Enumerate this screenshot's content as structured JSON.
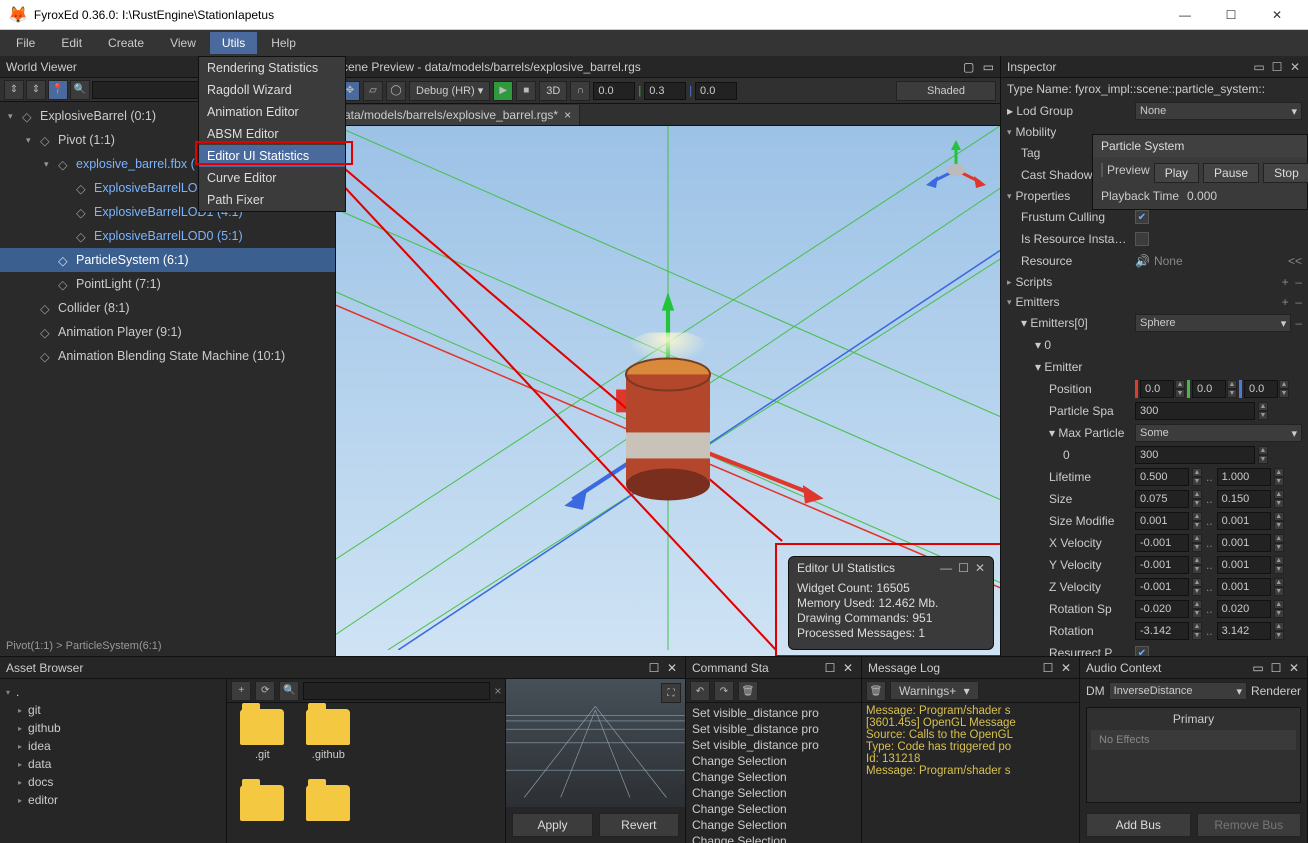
{
  "window": {
    "title": "FyroxEd  0.36.0: I:\\RustEngine\\StationIapetus"
  },
  "menubar": [
    "File",
    "Edit",
    "Create",
    "View",
    "Utils",
    "Help"
  ],
  "utils_dropdown": [
    "Rendering Statistics",
    "Ragdoll Wizard",
    "Animation Editor",
    "ABSM Editor",
    "Editor UI Statistics",
    "Curve Editor",
    "Path Fixer"
  ],
  "world": {
    "title": "World Viewer",
    "tree": [
      {
        "d": 0,
        "label": "ExplosiveBarrel (0:1)",
        "exp": "▾"
      },
      {
        "d": 1,
        "label": "Pivot (1:1)",
        "exp": "▾"
      },
      {
        "d": 2,
        "label": "explosive_barrel.fbx (",
        "exp": "▾",
        "link": true,
        "covered": true
      },
      {
        "d": 3,
        "label": "ExplosiveBarrelLOD",
        "link": true,
        "covered": true
      },
      {
        "d": 3,
        "label": "ExplosiveBarrelLOD1 (4:1)",
        "link": true
      },
      {
        "d": 3,
        "label": "ExplosiveBarrelLOD0 (5:1)",
        "link": true
      },
      {
        "d": 2,
        "label": "ParticleSystem (6:1)",
        "sel": true
      },
      {
        "d": 2,
        "label": "PointLight (7:1)"
      },
      {
        "d": 1,
        "label": "Collider (8:1)"
      },
      {
        "d": 1,
        "label": "Animation Player (9:1)"
      },
      {
        "d": 1,
        "label": "Animation Blending State Machine (10:1)"
      }
    ],
    "breadcrumb": "Pivot(1:1) > ParticleSystem(6:1)"
  },
  "scene": {
    "title_pre": "cene Preview - data/models/barrels/explosive_barrel.rgs",
    "tab": "ata/models/barrels/explosive_barrel.rgs*",
    "debug_label": "Debug (HR)",
    "shaded": "Shaded",
    "n1": "0.0",
    "n2": "0.3",
    "n3": "0.0",
    "threeD": "3D"
  },
  "stats": {
    "title": "Editor UI Statistics",
    "lines": [
      "Widget Count: 16505",
      "Memory Used: 12.462 Mb.",
      "Drawing Commands: 951",
      "Processed Messages: 1"
    ]
  },
  "inspector": {
    "title": "Inspector",
    "type_name": "Type Name: fyrox_impl::scene::particle_system::",
    "lod_group": "Lod Group",
    "lod_val": "None",
    "mobility": "Mobility",
    "tag": "Tag",
    "cast_shadows": "Cast Shadows",
    "properties": "Properties",
    "frustum": "Frustum Culling",
    "is_res": "Is Resource Instance",
    "resource": "Resource",
    "res_val": "None",
    "scripts": "Scripts",
    "emitters": "Emitters",
    "emitters0": "Emitters[0]",
    "em0_val": "Sphere",
    "idx0": "0",
    "emitter": "Emitter",
    "position": "Position",
    "pos": [
      "0.0",
      "0.0",
      "0.0"
    ],
    "particle_spa": "Particle Spa",
    "pspa": "300",
    "max_particle": "Max Particle",
    "max_val": "Some",
    "zero": "0",
    "zero_val": "300",
    "lifetime": "Lifetime",
    "lifetime_v": [
      "0.500",
      "1.000"
    ],
    "size": "Size",
    "size_v": [
      "0.075",
      "0.150"
    ],
    "size_mod": "Size Modifie",
    "size_mod_v": [
      "0.001",
      "0.001"
    ],
    "xvel": "X Velocity",
    "xvel_v": [
      "-0.001",
      "0.001"
    ],
    "yvel": "Y Velocity",
    "yvel_v": [
      "-0.001",
      "0.001"
    ],
    "zvel": "Z Velocity",
    "zvel_v": [
      "-0.001",
      "0.001"
    ],
    "rotsp": "Rotation Sp",
    "rotsp_v": [
      "-0.020",
      "0.020"
    ],
    "rotation": "Rotation",
    "rotation_v": [
      "-3.142",
      "3.142"
    ],
    "resurrect": "Resurrect P",
    "overlay": {
      "title": "Particle System",
      "preview": "Preview",
      "play": "Play",
      "pause": "Pause",
      "stop": "Stop",
      "playback": "Playback Time",
      "pb_val": "0.000"
    }
  },
  "asset": {
    "title": "Asset Browser",
    "root": ".",
    "dirs": [
      "git",
      "github",
      "idea",
      "data",
      "docs",
      "editor"
    ],
    "folders": [
      ".git",
      ".github"
    ],
    "apply": "Apply",
    "revert": "Revert"
  },
  "cmdstack": {
    "title": "Command Sta",
    "rows": [
      "Set visible_distance pro",
      "Set visible_distance pro",
      "Set visible_distance pro",
      "Change Selection",
      "Change Selection",
      "Change Selection",
      "Change Selection",
      "Change Selection",
      "Change Selection"
    ]
  },
  "msglog": {
    "title": "Message Log",
    "filter": "Warnings+",
    "rows": [
      "    Message: Program/shader s",
      "",
      "[3601.45s] OpenGL Message",
      "    Source: Calls to the OpenGL",
      "    Type: Code has triggered po",
      "    Id: 131218",
      "    Message: Program/shader s"
    ]
  },
  "audio": {
    "title": "Audio Context",
    "dm": "DM",
    "dm_val": "InverseDistance",
    "renderer": "Renderer",
    "primary": "Primary",
    "noeffects": "No Effects",
    "add": "Add Bus",
    "remove": "Remove Bus"
  }
}
